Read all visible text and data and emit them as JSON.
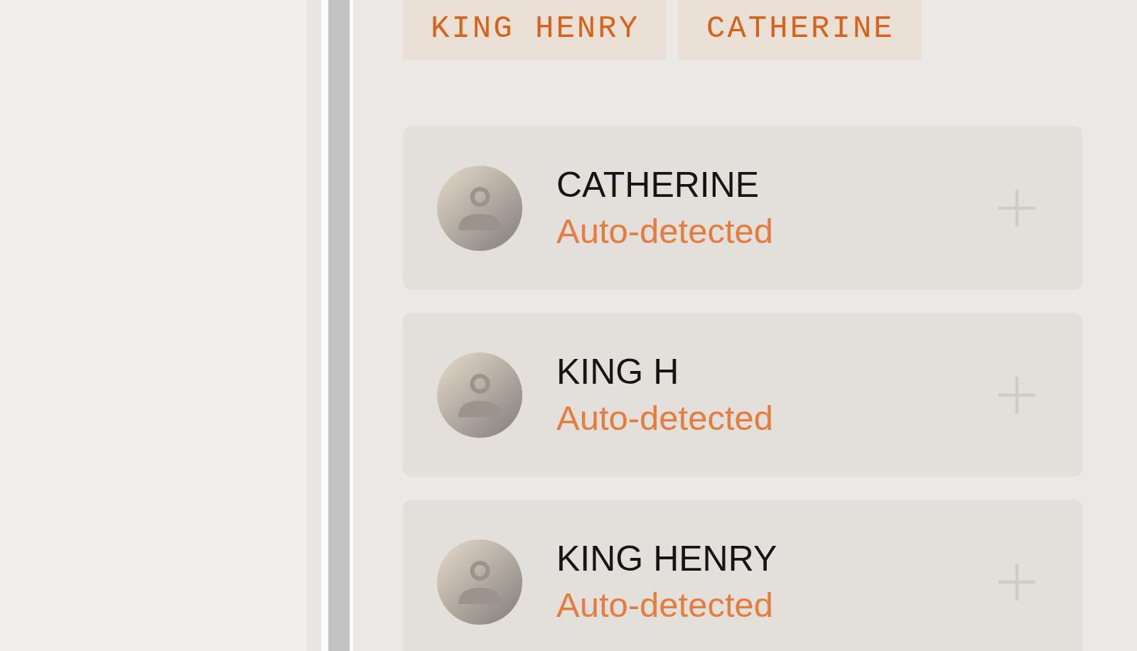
{
  "tags": [
    {
      "label": "KING HENRY"
    },
    {
      "label": "CATHERINE"
    }
  ],
  "characters": [
    {
      "name": "CATHERINE",
      "status": "Auto-detected"
    },
    {
      "name": "KING H",
      "status": "Auto-detected"
    },
    {
      "name": "KING HENRY",
      "status": "Auto-detected"
    }
  ]
}
